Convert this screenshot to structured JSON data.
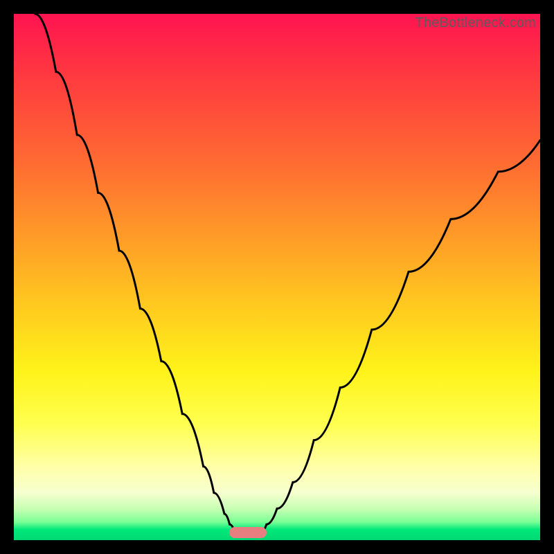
{
  "watermark": "TheBottleneck.com",
  "chart_data": {
    "type": "line",
    "title": "",
    "xlabel": "",
    "ylabel": "",
    "xlim": [
      0,
      100
    ],
    "ylim": [
      0,
      100
    ],
    "grid": false,
    "legend": false,
    "description": "Bottleneck funnel curve over red-to-green vertical gradient; two black curved branches descending from upper edges to meet at a minimum near the bottom, with a small rounded marker at the trough.",
    "series": [
      {
        "name": "left-branch",
        "x": [
          4,
          8,
          12,
          16,
          20,
          24,
          28,
          32,
          36,
          38,
          40,
          41,
          42
        ],
        "y": [
          100,
          89,
          77,
          66,
          55,
          44,
          34,
          24,
          14,
          9,
          5,
          3,
          1.5
        ]
      },
      {
        "name": "right-branch",
        "x": [
          47,
          48,
          50,
          53,
          57,
          62,
          68,
          75,
          83,
          92,
          100
        ],
        "y": [
          1.5,
          3,
          6,
          11,
          19,
          29,
          40,
          51,
          61,
          70,
          76
        ]
      }
    ],
    "marker": {
      "x": 44.5,
      "y": 1.5
    },
    "gradient_stops": [
      {
        "pos": 0,
        "color": "#ff1450"
      },
      {
        "pos": 0.12,
        "color": "#ff3a3f"
      },
      {
        "pos": 0.28,
        "color": "#ff6a32"
      },
      {
        "pos": 0.42,
        "color": "#ff9a28"
      },
      {
        "pos": 0.55,
        "color": "#ffc81f"
      },
      {
        "pos": 0.68,
        "color": "#fff31a"
      },
      {
        "pos": 0.78,
        "color": "#ffff50"
      },
      {
        "pos": 0.86,
        "color": "#ffffa8"
      },
      {
        "pos": 0.91,
        "color": "#f6ffcf"
      },
      {
        "pos": 0.94,
        "color": "#c8ffb4"
      },
      {
        "pos": 0.965,
        "color": "#7dff96"
      },
      {
        "pos": 0.98,
        "color": "#00e87a"
      },
      {
        "pos": 1.0,
        "color": "#00d872"
      }
    ]
  }
}
